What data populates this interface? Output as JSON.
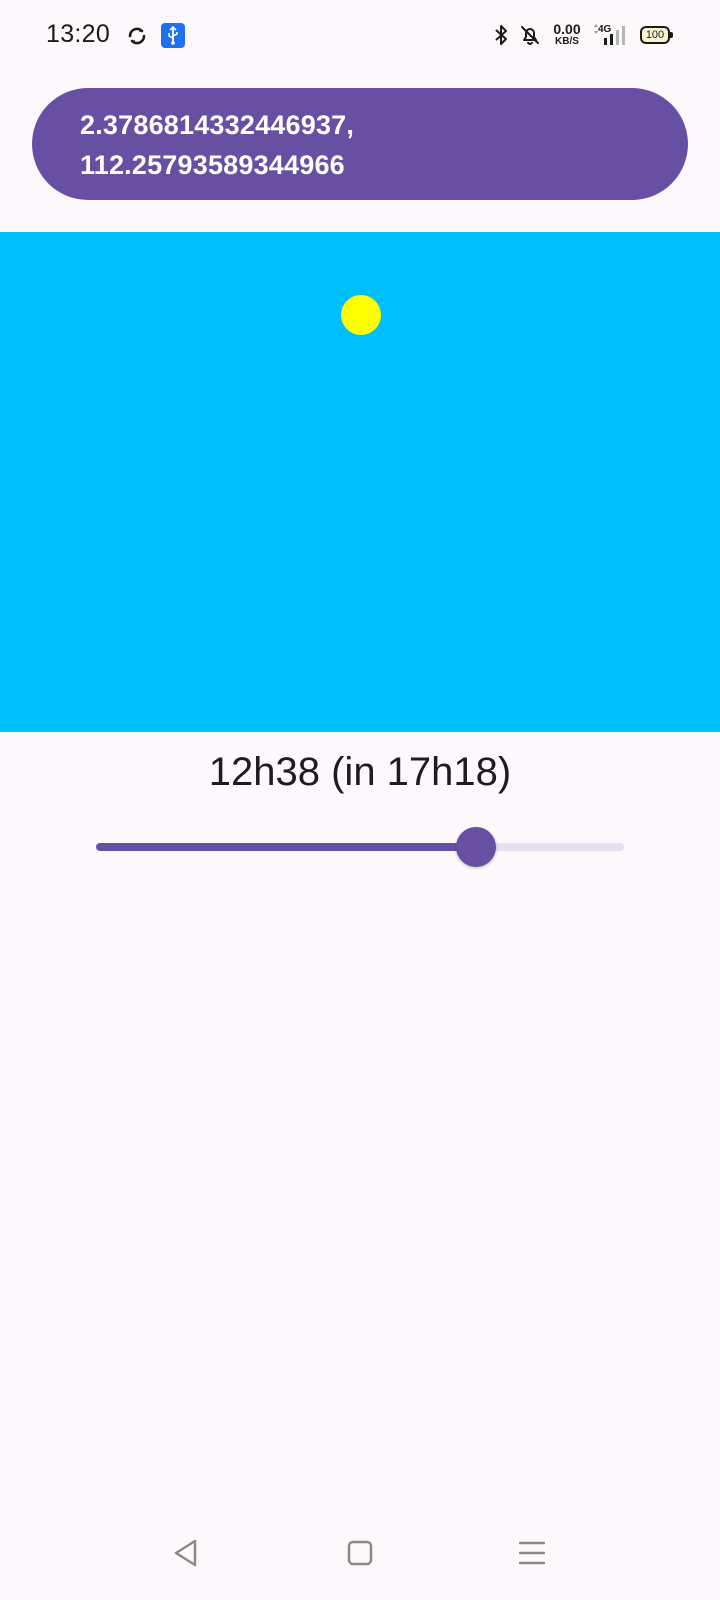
{
  "status_bar": {
    "time": "13:20",
    "net_speed_value": "0.00",
    "net_speed_unit": "KB/S",
    "network_type": "4G",
    "battery_level": "100",
    "icons": [
      "sync-icon",
      "usb-icon",
      "bluetooth-icon",
      "bell-muted-icon",
      "signal-icon",
      "battery-icon"
    ]
  },
  "coordinates": {
    "latitude_line": "2.3786814332446937,",
    "longitude_line": "112.25793589344966"
  },
  "sky": {
    "background_color": "#00bfff",
    "sun_color": "#ffff00"
  },
  "time_display": "12h38 (in 17h18)",
  "slider": {
    "value_fraction": 0.72,
    "accent_color": "#6750a4",
    "track_color": "#e7e0ec"
  },
  "nav_bar": {
    "icons": [
      "back-icon",
      "home-icon",
      "recents-icon"
    ]
  }
}
